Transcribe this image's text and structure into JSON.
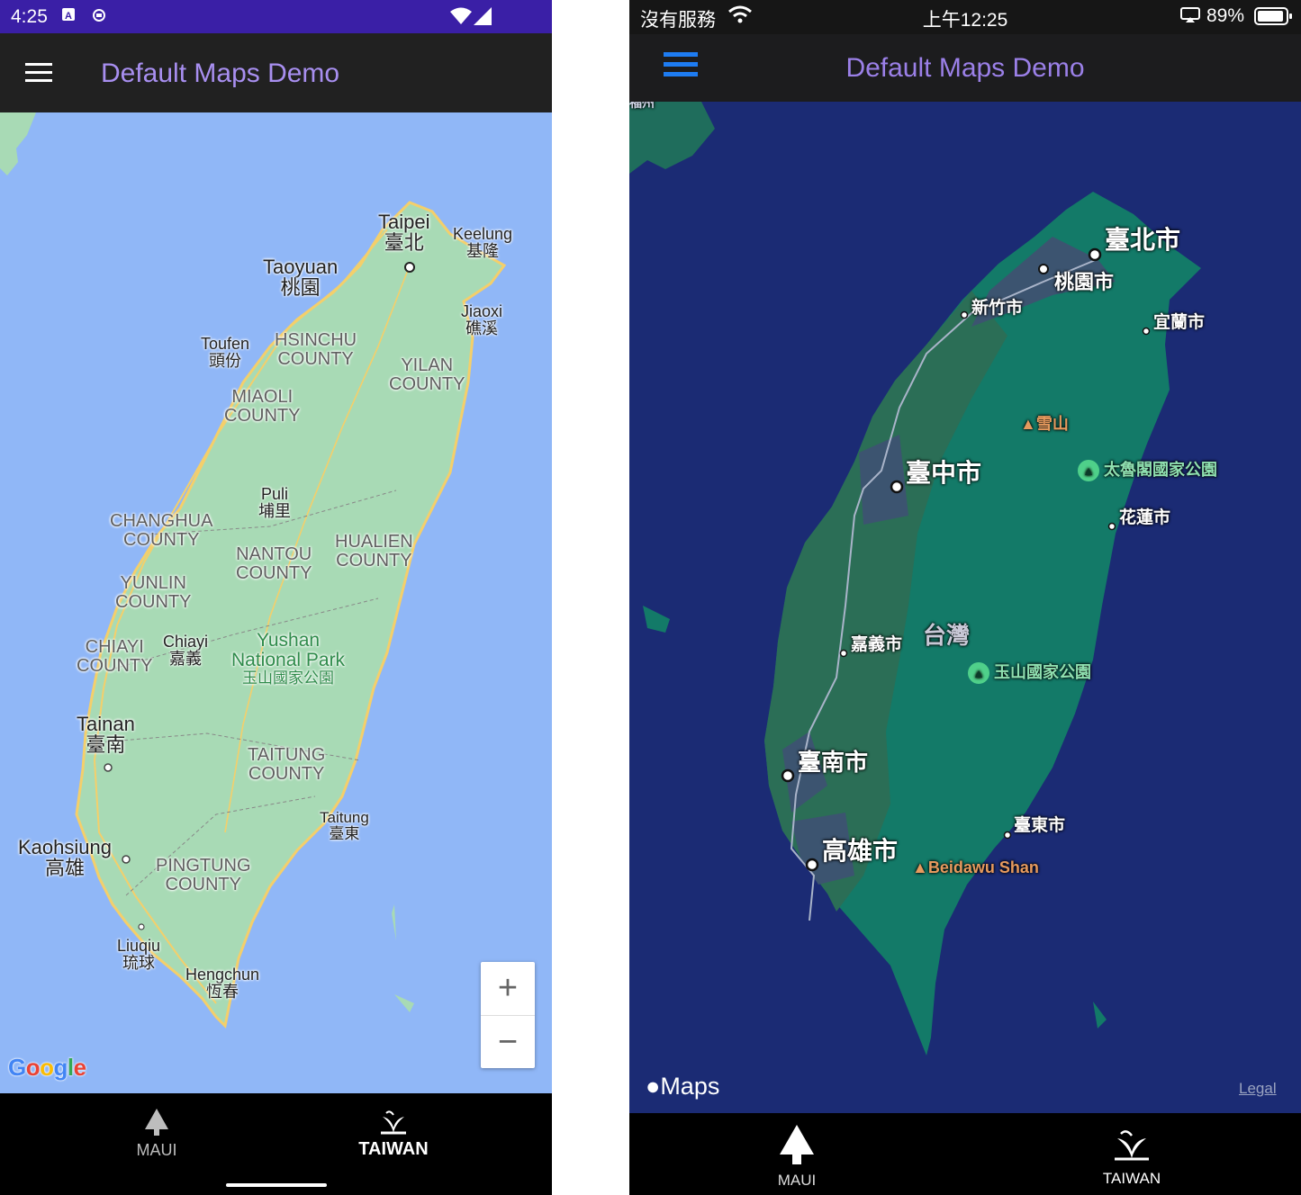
{
  "android": {
    "status": {
      "time": "4:25"
    },
    "app_title": "Default Maps Demo",
    "map": {
      "cities": [
        {
          "en": "Taipei",
          "zh": "臺北"
        },
        {
          "en": "Keelung",
          "zh": "基隆"
        },
        {
          "en": "Taoyuan",
          "zh": "桃園"
        },
        {
          "en": "Jiaoxi",
          "zh": "礁溪"
        },
        {
          "en": "Toufen",
          "zh": "頭份"
        },
        {
          "en": "Puli",
          "zh": "埔里"
        },
        {
          "en": "Chiayi",
          "zh": "嘉義"
        },
        {
          "en": "Tainan",
          "zh": "臺南"
        },
        {
          "en": "Taitung",
          "zh": "臺東"
        },
        {
          "en": "Kaohsiung",
          "zh": "高雄"
        },
        {
          "en": "Liuqiu",
          "zh": "琉球"
        },
        {
          "en": "Hengchun",
          "zh": "恆春"
        }
      ],
      "counties": [
        {
          "l1": "HSINCHU",
          "l2": "COUNTY"
        },
        {
          "l1": "YILAN",
          "l2": "COUNTY"
        },
        {
          "l1": "MIAOLI",
          "l2": "COUNTY"
        },
        {
          "l1": "CHANGHUA",
          "l2": "COUNTY"
        },
        {
          "l1": "NANTOU",
          "l2": "COUNTY"
        },
        {
          "l1": "HUALIEN",
          "l2": "COUNTY"
        },
        {
          "l1": "YUNLIN",
          "l2": "COUNTY"
        },
        {
          "l1": "CHIAYI",
          "l2": "COUNTY"
        },
        {
          "l1": "TAITUNG",
          "l2": "COUNTY"
        },
        {
          "l1": "PINGTUNG",
          "l2": "COUNTY"
        }
      ],
      "park": {
        "l1": "Yushan",
        "l2": "National Park",
        "l3": "玉山國家公園"
      },
      "zoom_in": "+",
      "zoom_out": "−",
      "brand_letters": [
        "G",
        "o",
        "o",
        "g",
        "l",
        "e"
      ],
      "brand_colors": [
        "#4285F4",
        "#EA4335",
        "#FBBC05",
        "#4285F4",
        "#34A853",
        "#EA4335"
      ]
    },
    "tabs": [
      {
        "label": "MAUI",
        "icon": "tree-icon",
        "selected": false
      },
      {
        "label": "TAIWAN",
        "icon": "palm-icon",
        "selected": true
      }
    ]
  },
  "ios": {
    "status": {
      "carrier": "沒有服務",
      "time": "上午12:25",
      "battery": "89%"
    },
    "app_title": "Default Maps Demo",
    "map": {
      "top_partial": "福州",
      "cities": [
        "臺北市",
        "桃園市",
        "新竹市",
        "宜蘭市",
        "臺中市",
        "花蓮市",
        "嘉義市",
        "臺南市",
        "高雄市",
        "臺東市"
      ],
      "region": "台灣",
      "peaks": [
        "雪山",
        "Beidawu Shan"
      ],
      "parks": [
        "太魯閣國家公園",
        "玉山國家公園"
      ],
      "brand": "Maps",
      "legal": "Legal"
    },
    "tabs": [
      {
        "label": "MAUI",
        "icon": "tree-icon"
      },
      {
        "label": "TAIWAN",
        "icon": "palm-icon"
      }
    ]
  },
  "colors": {
    "android_status": "#3a1fa6",
    "android_appbar": "#212121",
    "title_purple": "#a88ff0",
    "android_water": "#90b7f7",
    "android_land": "#a8dab5",
    "ios_water": "#1b2b74",
    "ios_land": "#137a68",
    "ios_accent": "#1e7cf2"
  }
}
